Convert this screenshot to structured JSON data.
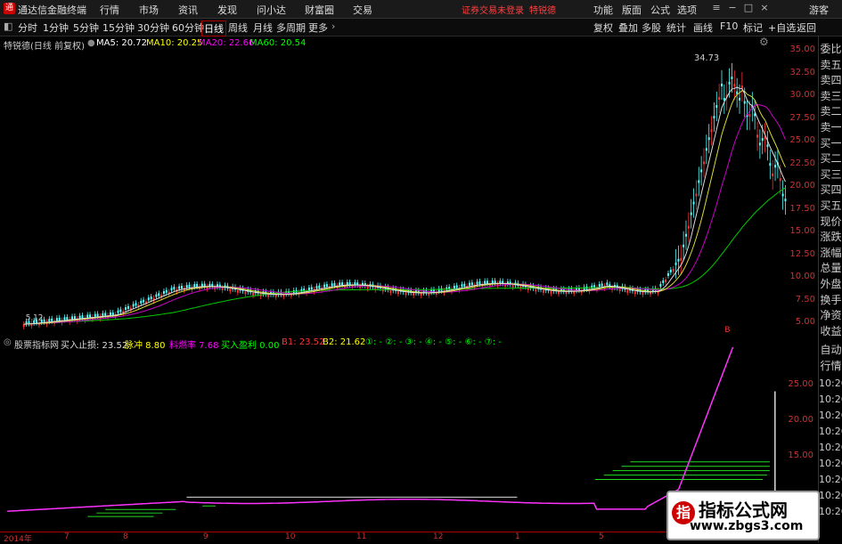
{
  "app": {
    "name": "通达信金融终端",
    "warning": "证券交易未登录",
    "stock_name": "特锐德"
  },
  "menu": [
    "行情",
    "市场",
    "资讯",
    "发现",
    "问小达",
    "财富圈",
    "交易"
  ],
  "title_right": [
    "功能",
    "版面",
    "公式",
    "选项"
  ],
  "guest": "游客",
  "toolbar": {
    "periods": [
      "分时",
      "1分钟",
      "5分钟",
      "15分钟",
      "30分钟",
      "60分钟",
      "日线",
      "周线",
      "月线",
      "多周期",
      "更多"
    ],
    "active": "日线",
    "right": [
      "复权",
      "叠加",
      "多股",
      "统计",
      "画线",
      "F10",
      "标记",
      "+自选",
      "返回"
    ]
  },
  "main_legend": {
    "title": "特锐德(日线 前复权)",
    "ma5": "MA5: 20.72",
    "ma10": "MA10: 20.25",
    "ma20": "MA20: 22.66",
    "ma60": "MA60: 20.54"
  },
  "main_yaxis": [
    "35.00",
    "32.50",
    "30.00",
    "27.50",
    "25.00",
    "22.50",
    "20.00",
    "17.50",
    "15.00",
    "12.50",
    "10.00",
    "7.50",
    "5.00"
  ],
  "main_labels": {
    "high": "34.73",
    "low": "5.12",
    "b_marker": "B"
  },
  "sub_legend": {
    "title": "股票指标网",
    "buy_stop": "买入止损: 23.52",
    "pulse": "脉冲 8.80",
    "fuel": "料燃率 7.68",
    "buy_profit": "买入盈利 0.00",
    "b1": "B1: 23.52",
    "b2": "B2: 21.62",
    "dots": "①: -  ②: -  ③: -  ④: -  ⑤: -  ⑥: -  ⑦: -"
  },
  "sub_yaxis": [
    "25.00",
    "20.00",
    "15.00"
  ],
  "dates": [
    "2014年",
    "7",
    "8",
    "9",
    "10",
    "11",
    "12",
    "1",
    "5"
  ],
  "side_panel": [
    "委比",
    "卖五",
    "卖四",
    "卖三",
    "卖二",
    "卖一",
    "买一",
    "买二",
    "买三",
    "买四",
    "买五",
    "现价",
    "涨跌",
    "涨幅",
    "总量",
    "外盘",
    "换手",
    "净资",
    "收益"
  ],
  "side_panel_lower": [
    "自动",
    "行情"
  ],
  "side_times": [
    "10:26",
    "10:26",
    "10:26",
    "10:26",
    "10:26",
    "10:26",
    "10:26",
    "10:26",
    "10:26"
  ],
  "watermark": {
    "line1": "指标公式网",
    "line2": "www.zbgs3.com"
  },
  "colors": {
    "up": "#ff3232",
    "down": "#54ffff",
    "ma5": "#ffffff",
    "ma10": "#ffff00",
    "ma20": "#ff00ff",
    "ma60": "#00ff00"
  }
}
